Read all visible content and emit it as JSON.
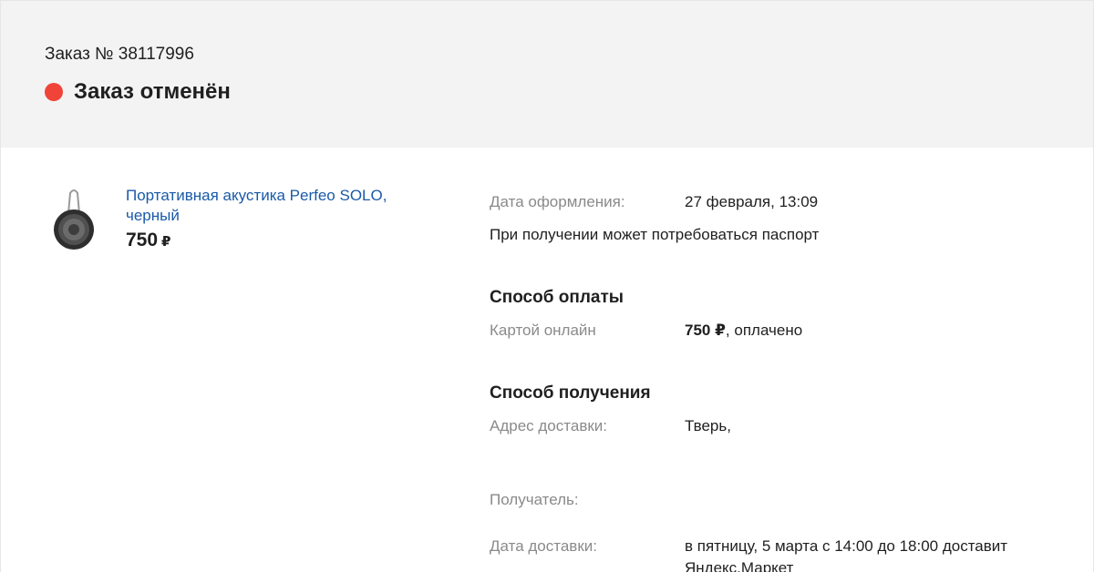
{
  "header": {
    "order_number": "Заказ № 38117996",
    "status": "Заказ отменён",
    "status_color": "#f04438"
  },
  "product": {
    "name": "Портативная акустика Perfeo SOLO, черный",
    "price": "750",
    "currency": "₽",
    "icon": "speaker-icon"
  },
  "details": {
    "order_date_label": "Дата оформления:",
    "order_date_value": "27 февраля, 13:09",
    "passport_note": "При получении может потребоваться паспорт"
  },
  "payment": {
    "title": "Способ оплаты",
    "method": "Картой онлайн",
    "amount": "750 ₽",
    "status": ", оплачено"
  },
  "delivery": {
    "title": "Способ получения",
    "address_label": "Адрес доставки:",
    "address_value": "Тверь,",
    "recipient_label": "Получатель:",
    "date_label": "Дата доставки:",
    "date_value_line1": "в пятницу, 5 марта с 14:00 до 18:00 доставит",
    "date_value_line2": "Яндекс.Маркет"
  }
}
